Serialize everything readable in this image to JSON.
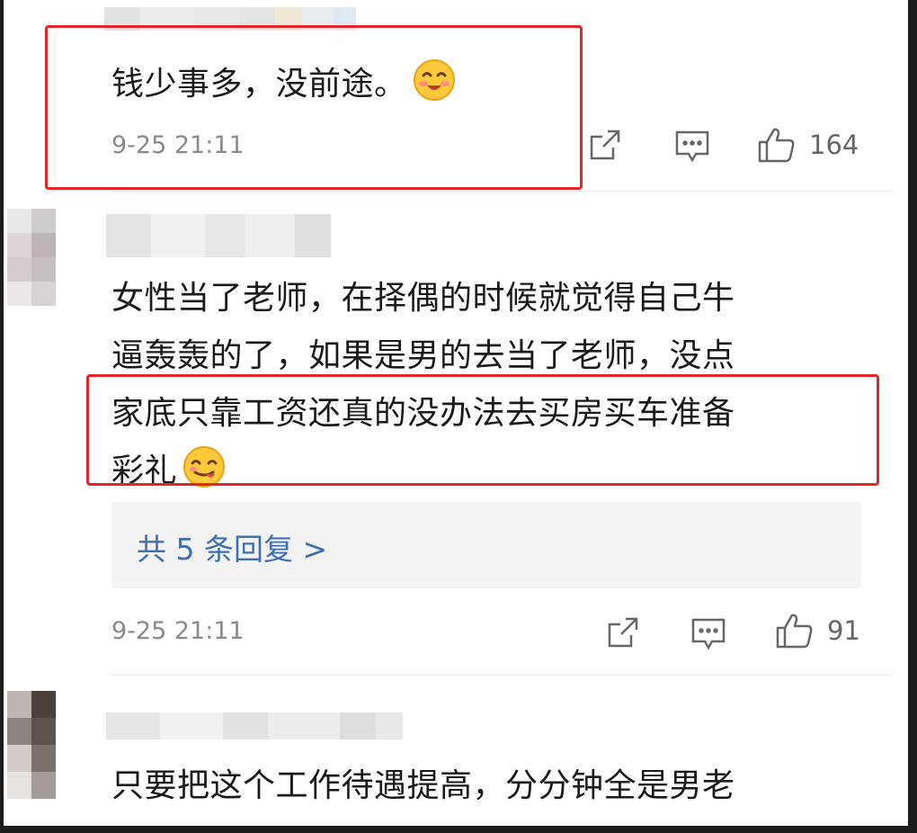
{
  "comments": [
    {
      "text_lines": [
        "钱少事多，没前途。"
      ],
      "emoji": "smiling-blush-emoji",
      "time": "9-25 21:11",
      "likes": "164"
    },
    {
      "text_lines": [
        "女性当了老师，在择偶的时候就觉得自己牛",
        "逼轰轰的了，如果是男的去当了老师，没点",
        "家底只靠工资还真的没办法去买房买车准备",
        "彩礼"
      ],
      "emoji": "yum-face-emoji",
      "reply_link": "共 5 条回复 >",
      "time": "9-25 21:11",
      "likes": "91"
    },
    {
      "text_lines": [
        "只要把这个工作待遇提高，分分钟全是男老"
      ]
    }
  ],
  "icons": {
    "share": "share-icon",
    "comment": "comment-icon",
    "like": "thumbs-up-icon"
  },
  "colors": {
    "highlight": "#e4262b",
    "link": "#3e6fb2",
    "meta": "#8a8a8a"
  }
}
